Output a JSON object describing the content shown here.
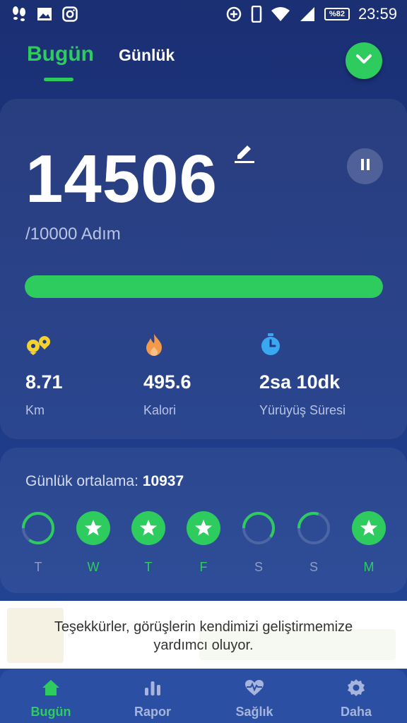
{
  "status_bar": {
    "time": "23:59",
    "battery": "%82",
    "left_icons": [
      "footsteps-icon",
      "image-icon",
      "instagram-icon"
    ],
    "right_icons": [
      "data-saver-icon",
      "phone-icon",
      "wifi-icon",
      "signal-icon"
    ]
  },
  "header": {
    "tab_today": "Bugün",
    "tab_daily": "Günlük",
    "dropdown_icon": "chevron-down-icon"
  },
  "main": {
    "steps": "14506",
    "goal": "/10000 Adım",
    "progress_fraction": 1.0,
    "stats": [
      {
        "icon": "distance-icon",
        "value": "8.71",
        "label": "Km",
        "color": "#f5d130"
      },
      {
        "icon": "flame-icon",
        "value": "495.6",
        "label": "Kalori",
        "color": "#f39a4a"
      },
      {
        "icon": "stopwatch-icon",
        "value": "2sa 10dk",
        "label": "Yürüyüş Süresi",
        "color": "#3aa8f0"
      }
    ]
  },
  "weekly": {
    "avg_label": "Günlük ortalama:",
    "avg_value": "10937",
    "days": [
      {
        "label": "T",
        "achieved": false,
        "fraction": 0.85
      },
      {
        "label": "W",
        "achieved": true,
        "fraction": 1
      },
      {
        "label": "T",
        "achieved": true,
        "fraction": 1
      },
      {
        "label": "F",
        "achieved": true,
        "fraction": 1
      },
      {
        "label": "S",
        "achieved": false,
        "fraction": 0.6
      },
      {
        "label": "S",
        "achieved": false,
        "fraction": 0.3
      },
      {
        "label": "M",
        "achieved": true,
        "fraction": 1
      }
    ]
  },
  "toast": {
    "line1": "Teşekkürler, görüşlerin kendimizi geliştirmemize",
    "line2": "yardımcı oluyor."
  },
  "nav": [
    {
      "icon": "home-icon",
      "label": "Bugün",
      "active": true
    },
    {
      "icon": "bar-chart-icon",
      "label": "Rapor",
      "active": false
    },
    {
      "icon": "heart-pulse-icon",
      "label": "Sağlık",
      "active": false
    },
    {
      "icon": "gear-icon",
      "label": "Daha",
      "active": false
    }
  ],
  "colors": {
    "accent": "#2ecc5f",
    "background": "#1d3a86"
  }
}
